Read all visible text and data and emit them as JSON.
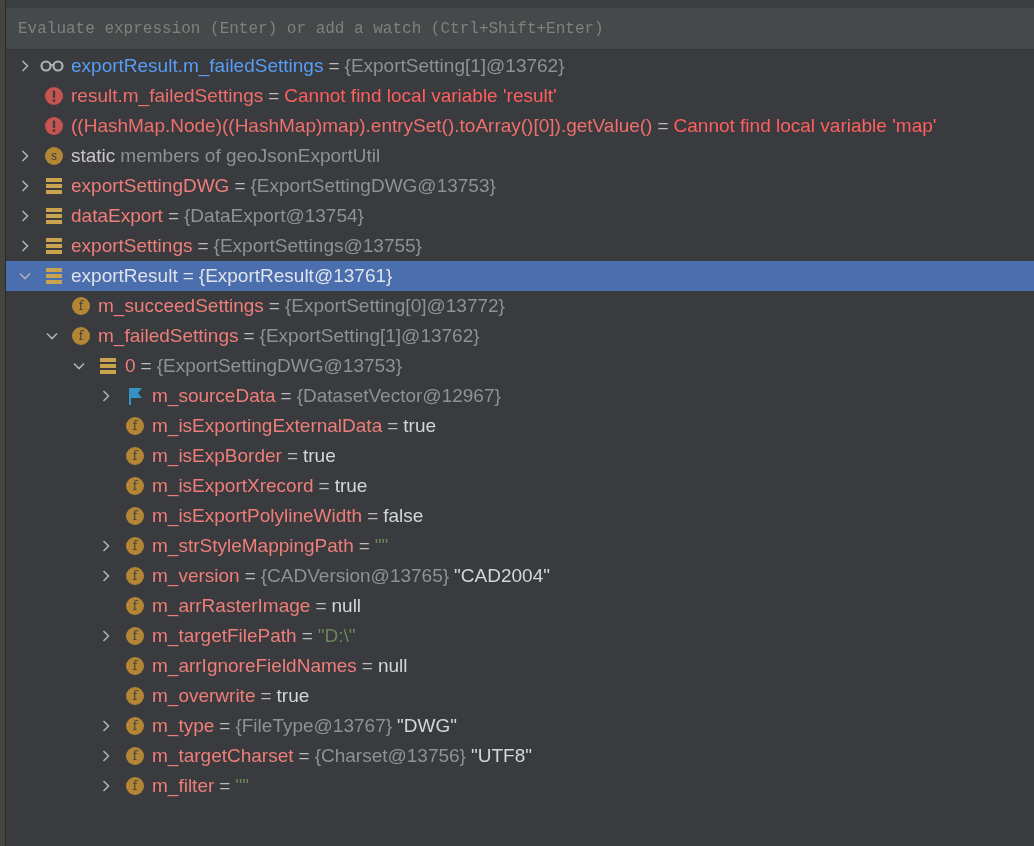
{
  "expression_field": {
    "placeholder": "Evaluate expression (Enter) or add a watch (Ctrl+Shift+Enter)"
  },
  "tree": [
    {
      "kind": "watch",
      "name": "exportResult.m_failedSettings",
      "equals": "=",
      "ref": "{ExportSetting[1]@13762}",
      "expanded": false,
      "selected": false
    },
    {
      "kind": "error",
      "name": "result.m_failedSettings",
      "equals": "=",
      "error_message": "Cannot find local variable 'result'",
      "selected": false
    },
    {
      "kind": "error",
      "name": "((HashMap.Node)((HashMap)map).entrySet().toArray()[0]).getValue()",
      "equals": "=",
      "error_message": "Cannot find local variable 'map'",
      "selected": false
    },
    {
      "kind": "static",
      "badge": "s",
      "name": "static",
      "detail": "members of geoJsonExportUtil",
      "expanded": false,
      "selected": false
    },
    {
      "kind": "variable",
      "name": "exportSettingDWG",
      "equals": "=",
      "ref": "{ExportSettingDWG@13753}",
      "expanded": false,
      "selected": false
    },
    {
      "kind": "variable",
      "name": "dataExport",
      "equals": "=",
      "ref": "{DataExport@13754}",
      "expanded": false,
      "selected": false
    },
    {
      "kind": "variable",
      "name": "exportSettings",
      "equals": "=",
      "ref": "{ExportSettings@13755}",
      "expanded": false,
      "selected": false
    },
    {
      "kind": "variable",
      "name": "exportResult",
      "equals": "=",
      "ref": "{ExportResult@13761}",
      "expanded": true,
      "selected": true,
      "children": [
        {
          "kind": "field",
          "badge": "f",
          "name": "m_succeedSettings",
          "equals": "=",
          "ref": "{ExportSetting[0]@13772}",
          "selected": false
        },
        {
          "kind": "field",
          "badge": "f",
          "name": "m_failedSettings",
          "equals": "=",
          "ref": "{ExportSetting[1]@13762}",
          "expanded": true,
          "selected": false,
          "children": [
            {
              "kind": "variable",
              "name": "0",
              "equals": "=",
              "ref": "{ExportSettingDWG@13753}",
              "expanded": true,
              "selected": false,
              "children": [
                {
                  "kind": "flag",
                  "name": "m_sourceData",
                  "equals": "=",
                  "ref": "{DatasetVector@12967}",
                  "expanded": false,
                  "selected": false
                },
                {
                  "kind": "field",
                  "badge": "f",
                  "name": "m_isExportingExternalData",
                  "equals": "=",
                  "value": "true",
                  "selected": false
                },
                {
                  "kind": "field",
                  "badge": "f",
                  "name": "m_isExpBorder",
                  "equals": "=",
                  "value": "true",
                  "selected": false
                },
                {
                  "kind": "field",
                  "badge": "f",
                  "name": "m_isExportXrecord",
                  "equals": "=",
                  "value": "true",
                  "selected": false
                },
                {
                  "kind": "field",
                  "badge": "f",
                  "name": "m_isExportPolylineWidth",
                  "equals": "=",
                  "value": "false",
                  "selected": false
                },
                {
                  "kind": "field",
                  "badge": "f",
                  "name": "m_strStyleMappingPath",
                  "equals": "=",
                  "string_value": "\"\"",
                  "expanded": false,
                  "selected": false
                },
                {
                  "kind": "field",
                  "badge": "f",
                  "name": "m_version",
                  "equals": "=",
                  "ref": "{CADVersion@13765}",
                  "value": "\"CAD2004\"",
                  "expanded": false,
                  "selected": false
                },
                {
                  "kind": "field",
                  "badge": "f",
                  "name": "m_arrRasterImage",
                  "equals": "=",
                  "value": "null",
                  "selected": false
                },
                {
                  "kind": "field",
                  "badge": "f",
                  "name": "m_targetFilePath",
                  "equals": "=",
                  "string_value": "\"D:\\\"",
                  "expanded": false,
                  "selected": false
                },
                {
                  "kind": "field",
                  "badge": "f",
                  "name": "m_arrIgnoreFieldNames",
                  "equals": "=",
                  "value": "null",
                  "selected": false
                },
                {
                  "kind": "field",
                  "badge": "f",
                  "name": "m_overwrite",
                  "equals": "=",
                  "value": "true",
                  "selected": false
                },
                {
                  "kind": "field",
                  "badge": "f",
                  "name": "m_type",
                  "equals": "=",
                  "ref": "{FileType@13767}",
                  "value": "\"DWG\"",
                  "expanded": false,
                  "selected": false
                },
                {
                  "kind": "field",
                  "badge": "f",
                  "name": "m_targetCharset",
                  "equals": "=",
                  "ref": "{Charset@13756}",
                  "value": "\"UTF8\"",
                  "expanded": false,
                  "selected": false
                },
                {
                  "kind": "field",
                  "badge": "f",
                  "name": "m_filter",
                  "equals": "=",
                  "string_value": "\"\"",
                  "expanded": false,
                  "selected": false
                }
              ]
            }
          ]
        }
      ]
    }
  ]
}
